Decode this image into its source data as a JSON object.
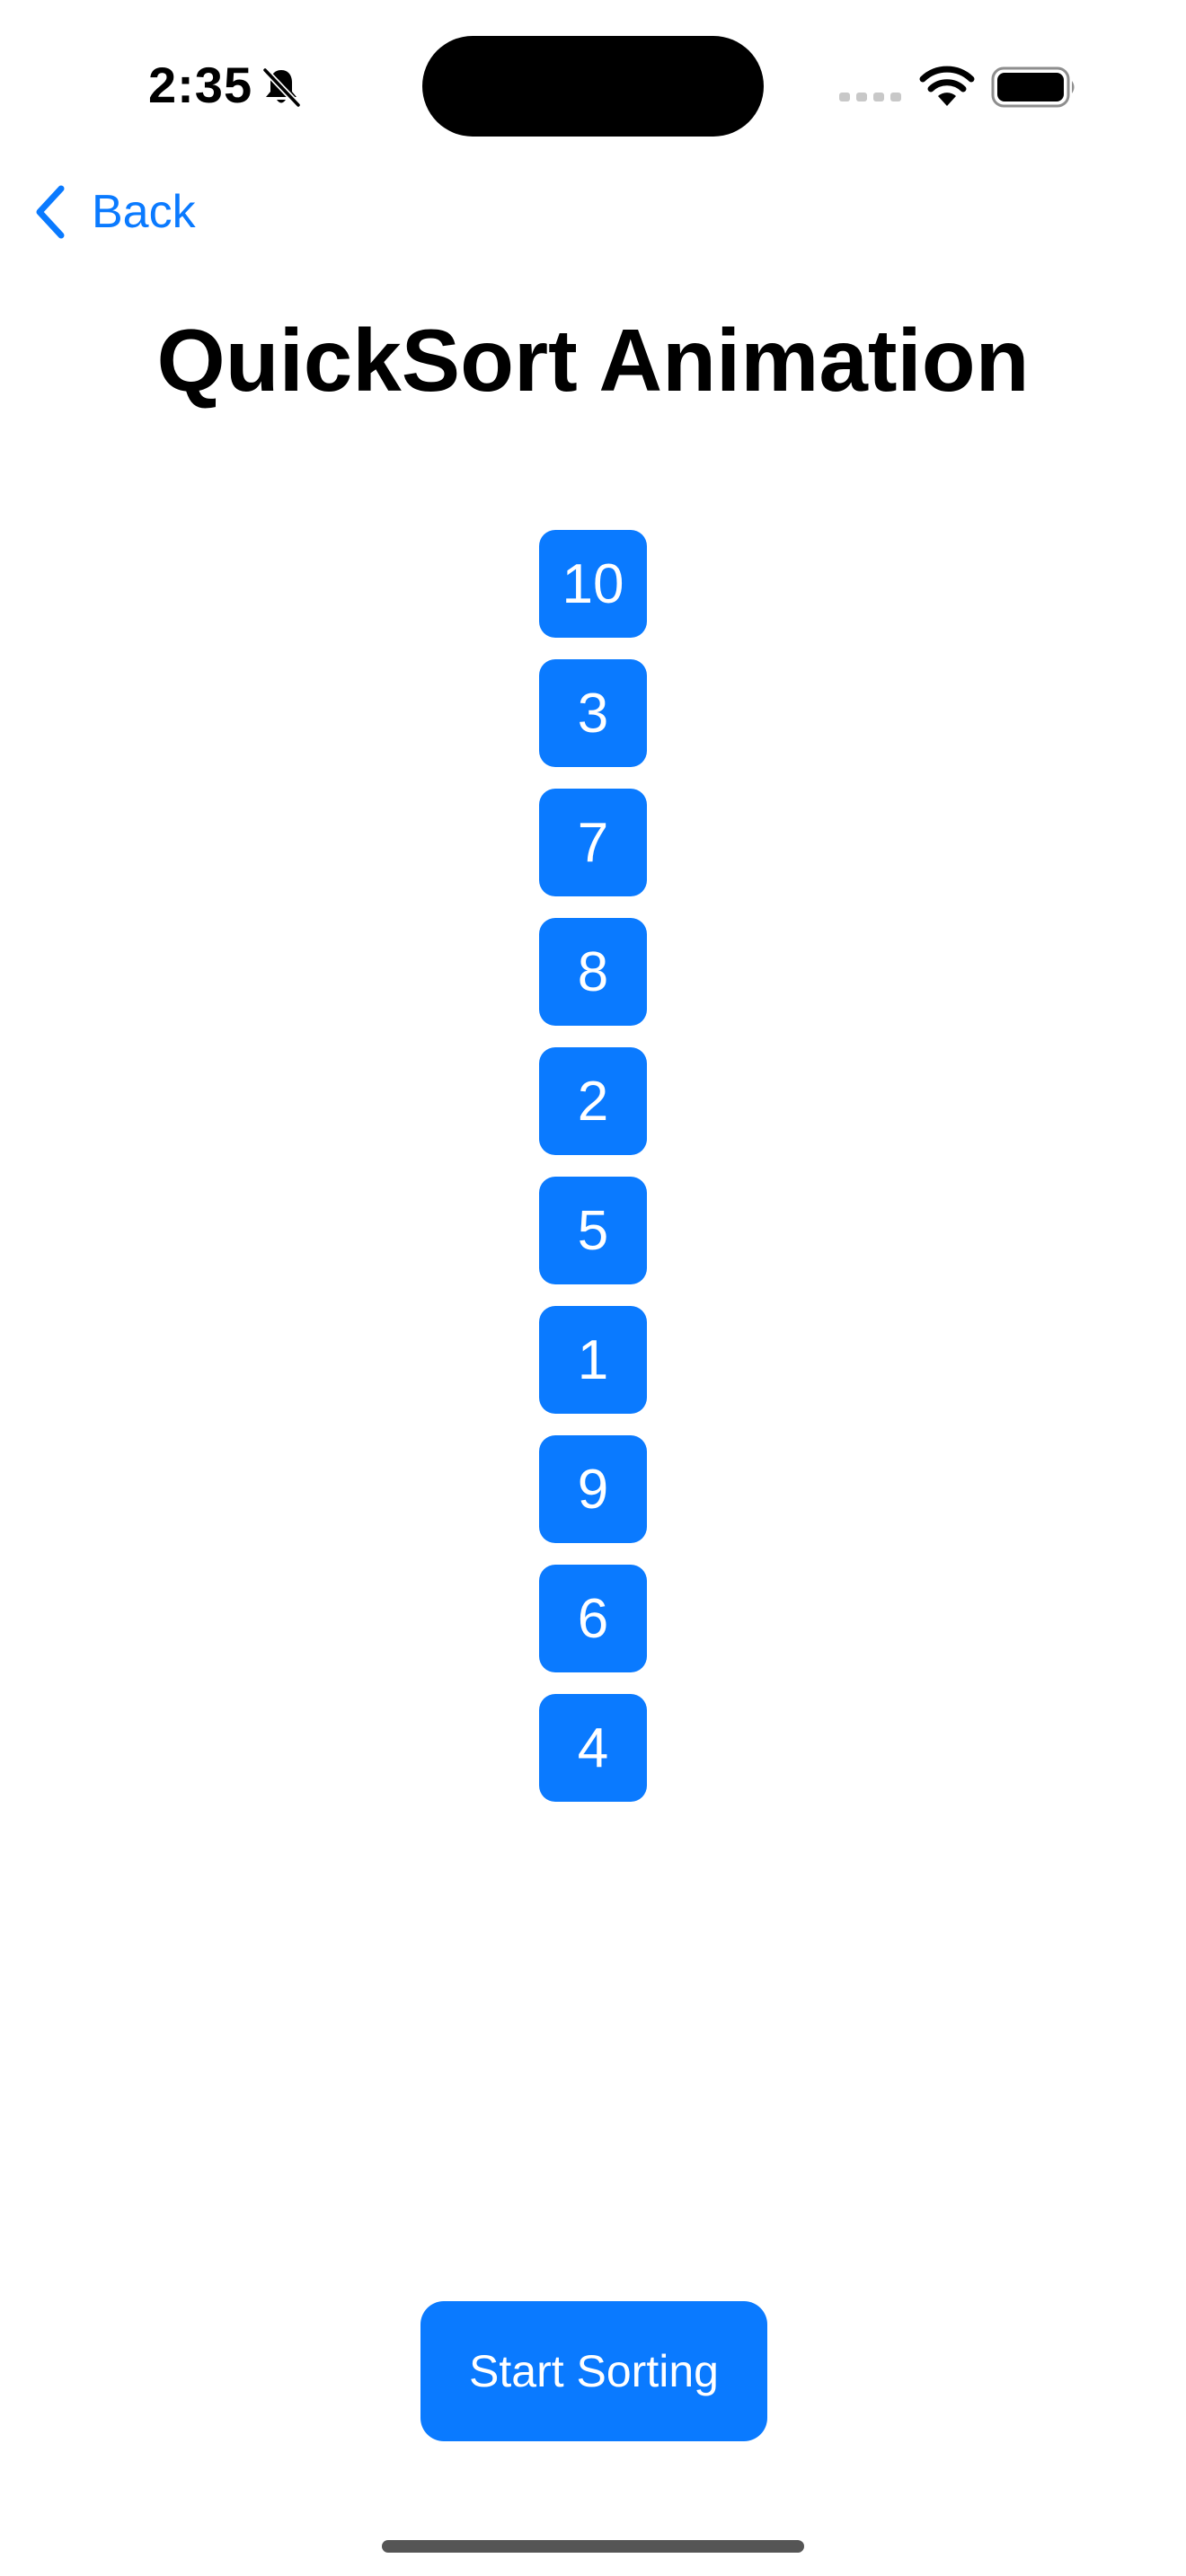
{
  "status_bar": {
    "time": "2:35",
    "icons": [
      "bell-slash-icon",
      "cellular-signal-icon",
      "wifi-icon",
      "battery-icon"
    ]
  },
  "nav": {
    "back_label": "Back",
    "accent_color": "#0A7AFF"
  },
  "page": {
    "title": "QuickSort Animation"
  },
  "numbers": [
    "10",
    "3",
    "7",
    "8",
    "2",
    "5",
    "1",
    "9",
    "6",
    "4"
  ],
  "actions": {
    "start_label": "Start Sorting"
  }
}
